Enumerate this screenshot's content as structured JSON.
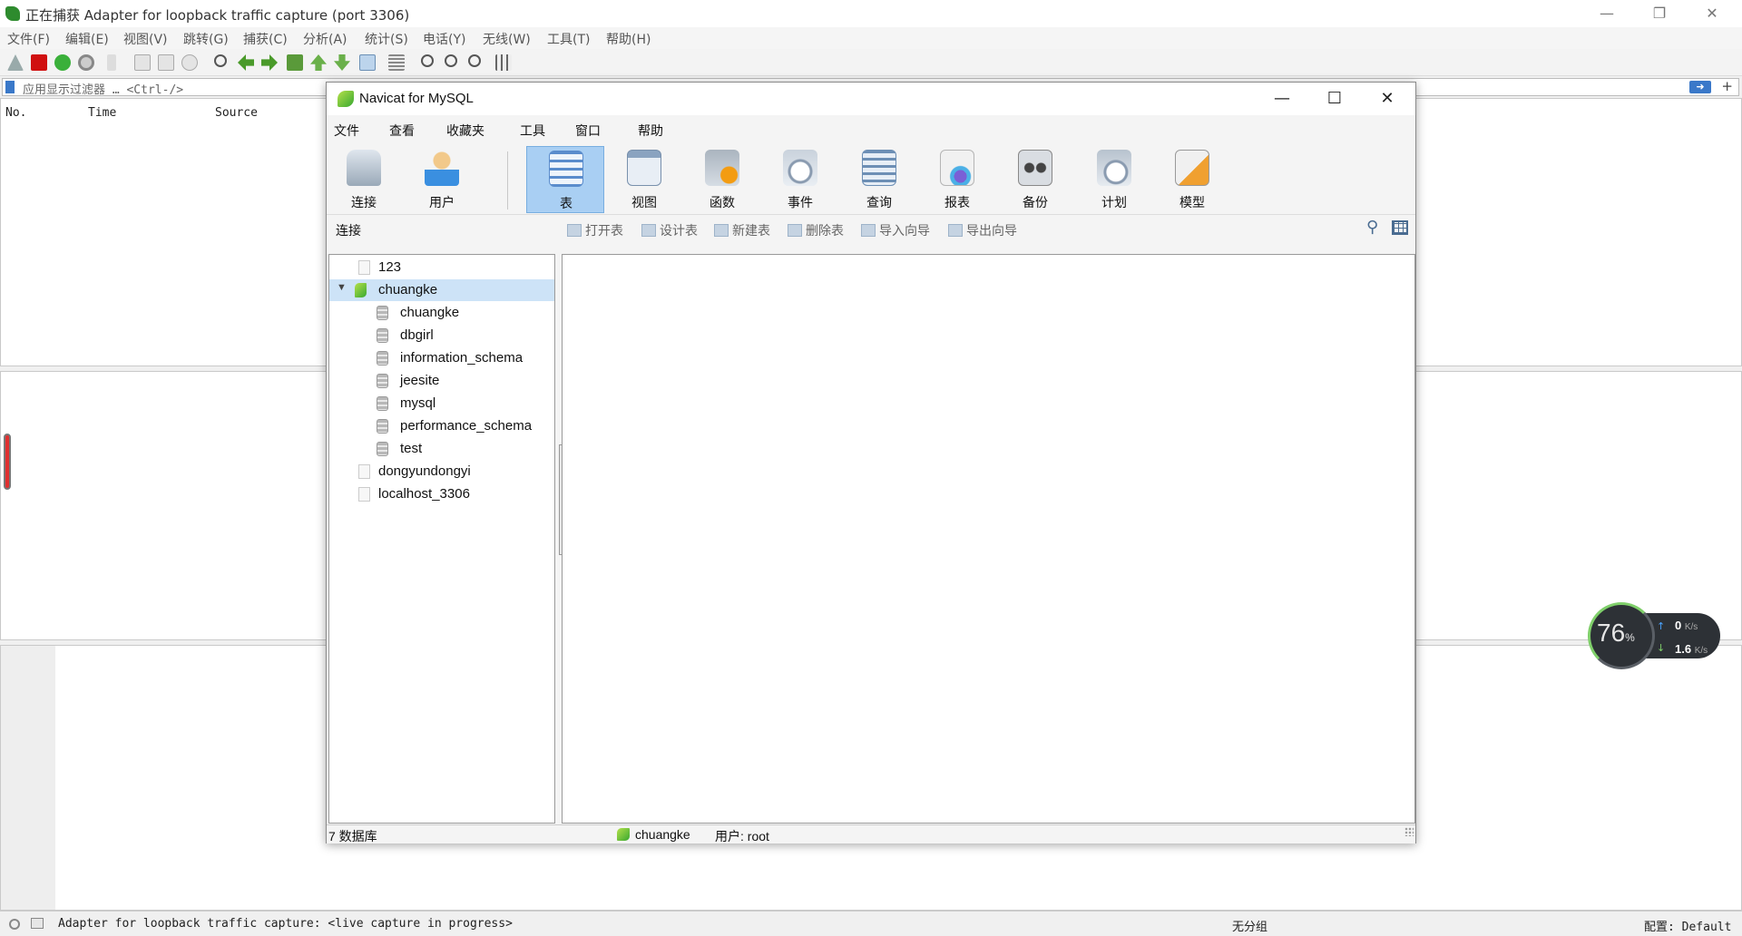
{
  "wireshark": {
    "title": "正在捕获 Adapter for loopback traffic capture (port 3306)",
    "menu": [
      "文件(F)",
      "编辑(E)",
      "视图(V)",
      "跳转(G)",
      "捕获(C)",
      "分析(A)",
      "统计(S)",
      "电话(Y)",
      "无线(W)",
      "工具(T)",
      "帮助(H)"
    ],
    "filter_placeholder": "应用显示过滤器 … <Ctrl-/>",
    "columns": [
      "No.",
      "Time",
      "Source"
    ],
    "status": {
      "capture_text": "Adapter for loopback traffic capture: <live capture in progress>",
      "group": "无分组",
      "profile": "配置: Default"
    }
  },
  "net_meter": {
    "percent": "76",
    "percent_unit": "%",
    "upload": "0",
    "upload_unit": "K/s",
    "download": "1.6",
    "download_unit": "K/s"
  },
  "navicat": {
    "title": "Navicat for MySQL",
    "menu": [
      "文件",
      "查看",
      "收藏夹",
      "工具",
      "窗口",
      "帮助"
    ],
    "tools": [
      {
        "label": "连接",
        "icon": "connection-icon"
      },
      {
        "label": "用户",
        "icon": "user-icon"
      },
      {
        "label": "表",
        "icon": "table-icon",
        "active": true
      },
      {
        "label": "视图",
        "icon": "view-icon"
      },
      {
        "label": "函数",
        "icon": "function-icon"
      },
      {
        "label": "事件",
        "icon": "event-icon"
      },
      {
        "label": "查询",
        "icon": "query-icon"
      },
      {
        "label": "报表",
        "icon": "report-icon"
      },
      {
        "label": "备份",
        "icon": "backup-icon"
      },
      {
        "label": "计划",
        "icon": "schedule-icon"
      },
      {
        "label": "模型",
        "icon": "model-icon"
      }
    ],
    "connection_label": "连接",
    "actions": [
      "打开表",
      "设计表",
      "新建表",
      "删除表",
      "导入向导",
      "导出向导"
    ],
    "tree": [
      {
        "label": "123",
        "type": "connection",
        "open": false
      },
      {
        "label": "chuangke",
        "type": "connection",
        "open": true,
        "selected": true
      },
      {
        "label": "chuangke",
        "type": "database"
      },
      {
        "label": "dbgirl",
        "type": "database"
      },
      {
        "label": "information_schema",
        "type": "database"
      },
      {
        "label": "jeesite",
        "type": "database"
      },
      {
        "label": "mysql",
        "type": "database"
      },
      {
        "label": "performance_schema",
        "type": "database"
      },
      {
        "label": "test",
        "type": "database"
      },
      {
        "label": "dongyundongyi",
        "type": "connection",
        "open": false
      },
      {
        "label": "localhost_3306",
        "type": "connection",
        "open": false
      }
    ],
    "status": {
      "db_count": "7 数据库",
      "connection": "chuangke",
      "user": "用户: root"
    }
  }
}
